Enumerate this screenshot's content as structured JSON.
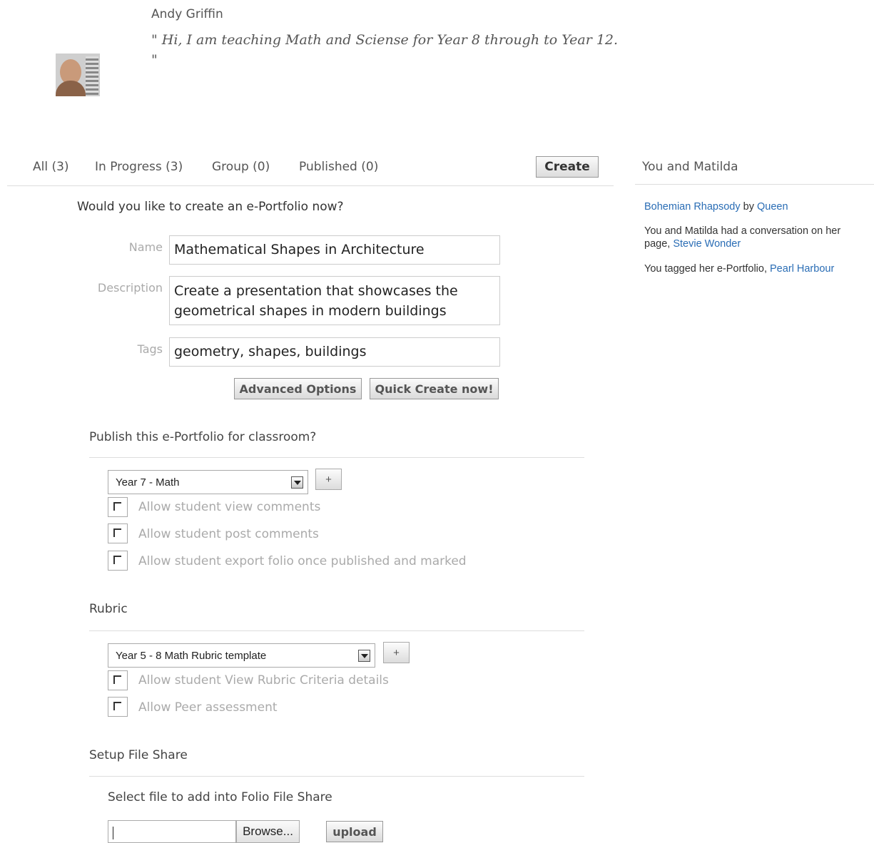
{
  "profile": {
    "name": "Andy Griffin",
    "quote_line1": "\" Hi, I am teaching Math and Sciense for Year 8 through to Year 12.",
    "quote_line2": "\""
  },
  "tabs": {
    "all": "All (3)",
    "in_progress": "In Progress (3)",
    "group": "Group (0)",
    "published": "Published (0)",
    "create_label": "Create"
  },
  "sidebar": {
    "title": "You and Matilda",
    "item1": {
      "link1": "Bohemian Rhapsody",
      "by": " by ",
      "link2": "Queen"
    },
    "item2": {
      "text": "You and Matilda had a conversation on her page, ",
      "link": "Stevie Wonder"
    },
    "item3": {
      "text": "You tagged her e-Portfolio, ",
      "link": "Pearl Harbour"
    }
  },
  "form": {
    "question": "Would you like to create an e-Portfolio now?",
    "name_label": "Name",
    "name_value": "Mathematical Shapes in Architecture",
    "description_label": "Description",
    "description_value": "Create a presentation that showcases the geometrical shapes in modern buildings",
    "tags_label": "Tags",
    "tags_value": "geometry, shapes, buildings",
    "advanced_label": "Advanced Options",
    "quick_create_label": "Quick Create now!"
  },
  "publish": {
    "title": "Publish this e-Portfolio for classroom?",
    "classroom_selected": "Year 7 - Math",
    "plus_label": "+",
    "options": [
      "Allow student view comments",
      "Allow student post comments",
      "Allow student export folio once published and marked"
    ]
  },
  "rubric": {
    "title": "Rubric",
    "template_selected": "Year 5 - 8 Math Rubric template",
    "plus_label": "+",
    "options": [
      "Allow student View Rubric Criteria details",
      "Allow Peer assessment"
    ]
  },
  "file_share": {
    "title": "Setup File Share",
    "select_label": "Select file to add into Folio File Share",
    "browse_label": "Browse...",
    "upload_label": "upload"
  },
  "icons": {
    "dropdown": "chevron-down-icon",
    "checkbox": "checkbox-checked-icon"
  },
  "colors": {
    "link": "#2a6db5",
    "muted_label": "#aaaaaa"
  }
}
